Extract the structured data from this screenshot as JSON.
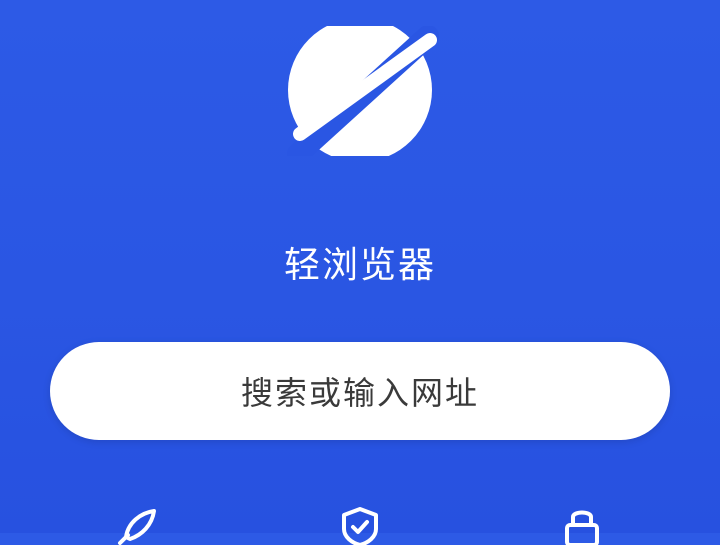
{
  "app": {
    "title": "轻浏览器",
    "logo_icon": "planet-icon"
  },
  "search": {
    "placeholder": "搜索或输入网址"
  },
  "quick_actions": [
    {
      "icon": "rocket-icon"
    },
    {
      "icon": "shield-check-icon"
    },
    {
      "icon": "lock-icon"
    }
  ],
  "colors": {
    "background": "#2a56e3",
    "text_on_background": "#ffffff",
    "search_bg": "#ffffff",
    "search_text": "#3a3a3a"
  }
}
